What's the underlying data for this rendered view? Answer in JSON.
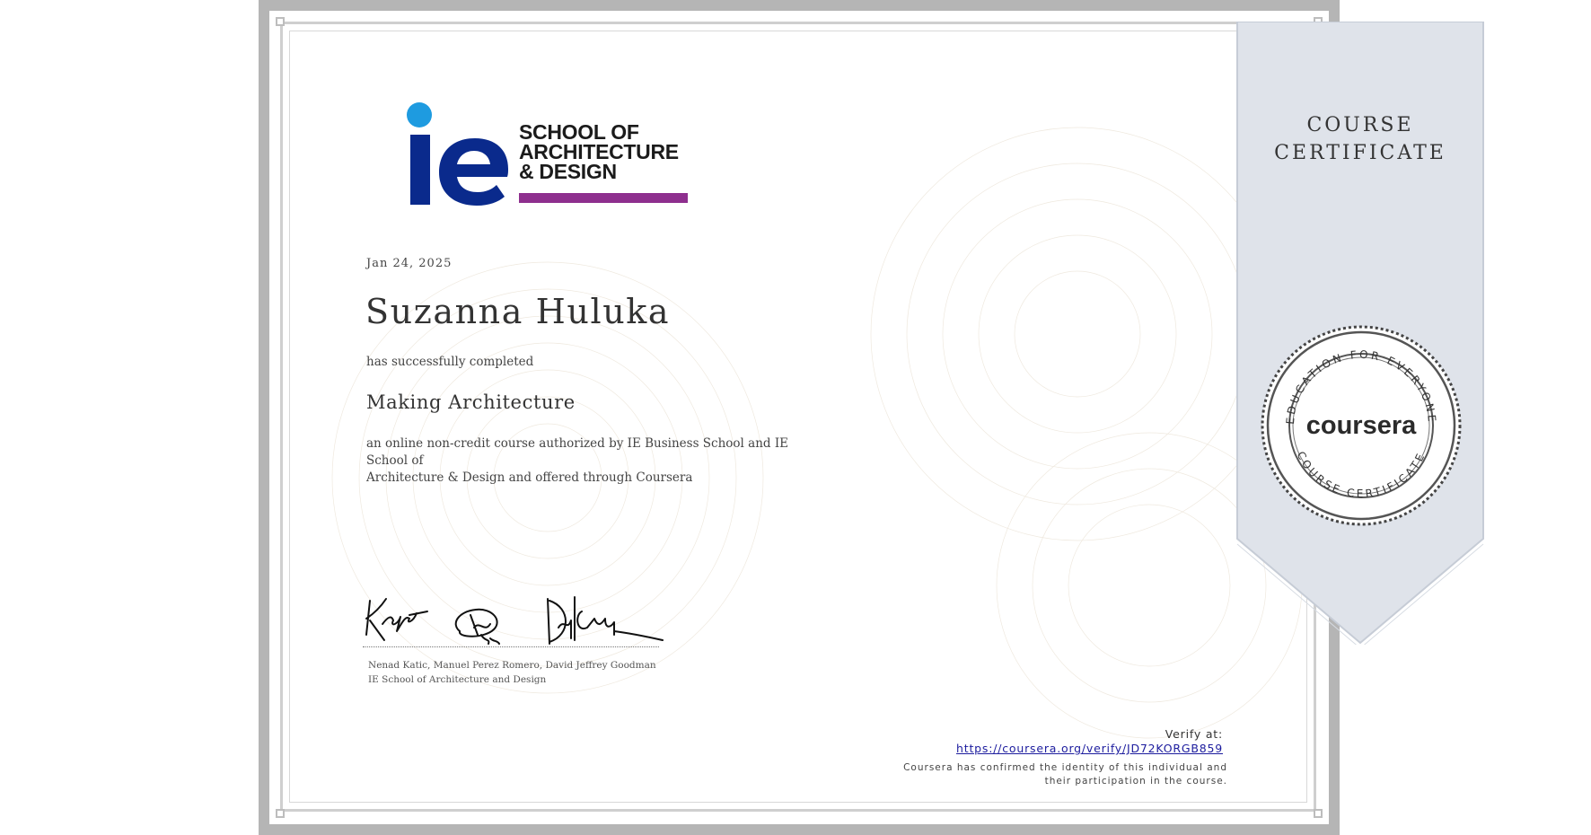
{
  "certificate": {
    "date": "Jan 24, 2025",
    "recipient_name": "Suzanna Huluka",
    "completion_phrase": "has successfully completed",
    "course_name": "Making Architecture",
    "course_description_line1": "an online non-credit course authorized by IE Business School and IE School of",
    "course_description_line2": "Architecture & Design and offered through Coursera",
    "signers_names": "Nenad Katic, Manuel Perez Romero, David Jeffrey Goodman",
    "signers_org": "IE School of Architecture and Design"
  },
  "logo": {
    "line1": "SCHOOL OF",
    "line2": "ARCHITECTURE",
    "line3": "& DESIGN",
    "brand_blue": "#0a2a8c",
    "brand_dot": "#1e9be0",
    "brand_purple": "#8e2f8e"
  },
  "ribbon": {
    "title_line1": "COURSE",
    "title_line2": "CERTIFICATE",
    "color": "#dfe3ea"
  },
  "seal": {
    "brand": "coursera",
    "top_arc_text": "EDUCATION FOR EVERYONE",
    "bottom_arc_text": "COURSE CERTIFICATE"
  },
  "verification": {
    "label": "Verify at:",
    "url": "https://coursera.org/verify/JD72KORGB859",
    "confirm_line1": "Coursera has confirmed the identity of this individual and",
    "confirm_line2": "their participation in the course."
  }
}
